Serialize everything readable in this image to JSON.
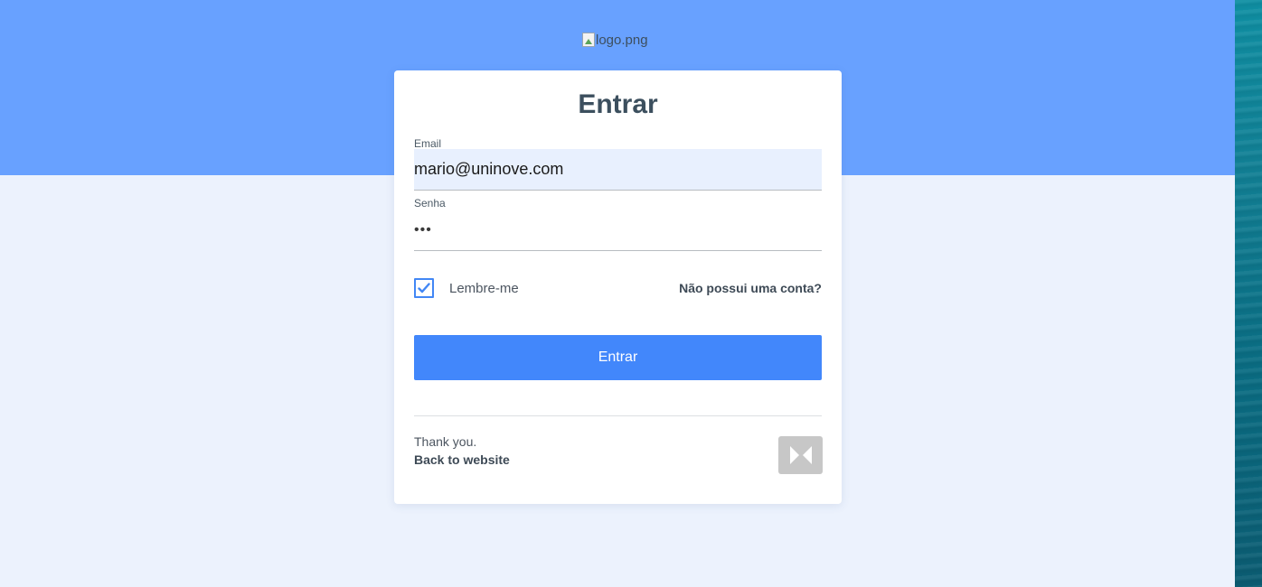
{
  "header": {
    "logo_alt": "logo.png"
  },
  "login": {
    "title": "Entrar",
    "email_label": "Email",
    "email_value": "mario@uninove.com",
    "password_label": "Senha",
    "password_value": "•••",
    "remember_label": "Lembre-me",
    "remember_checked": true,
    "signup_link": "Não possui uma conta?",
    "submit_label": "Entrar"
  },
  "footer": {
    "thanks": "Thank you.",
    "back_link": "Back to website",
    "badge_icon": "bowtie-logo-icon"
  },
  "colors": {
    "header_band": "#68a1ff",
    "background": "#ecf2fd",
    "primary_button": "#4287fb",
    "checkbox_accent": "#4287f5"
  }
}
